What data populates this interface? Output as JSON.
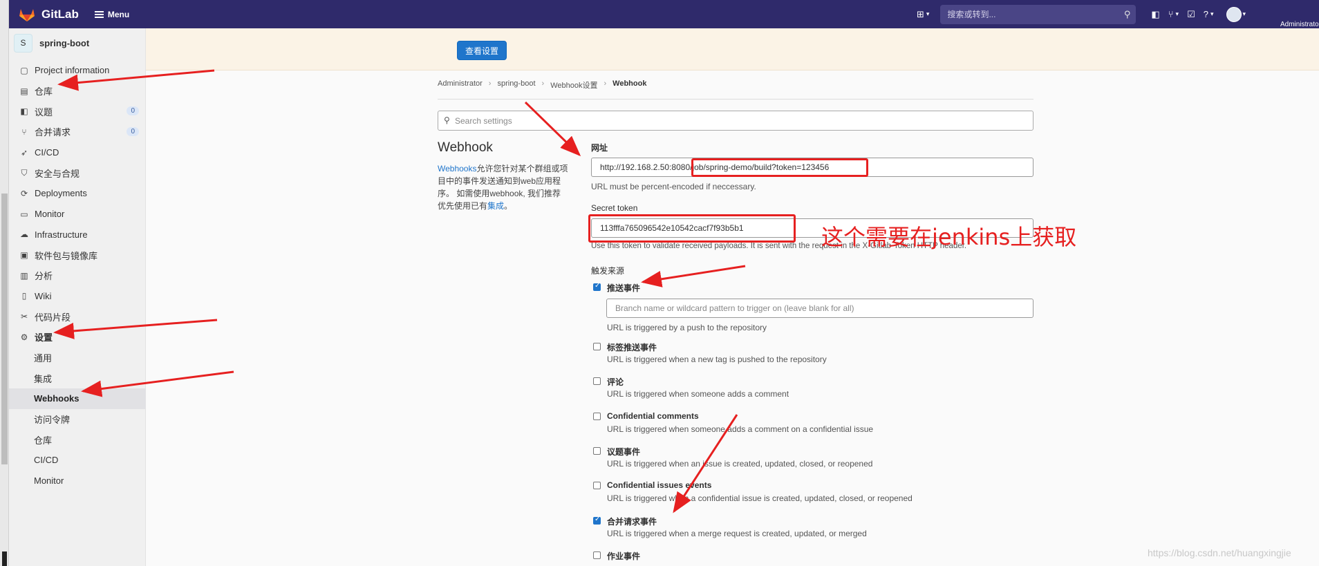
{
  "topbar": {
    "brand": "GitLab",
    "menu_label": "Menu",
    "search_placeholder": "搜索或转到...",
    "user_label": "Administrator"
  },
  "sidebar": {
    "project_initial": "S",
    "project_name": "spring-boot",
    "items": [
      {
        "label": "Project information",
        "icon": "info-icon"
      },
      {
        "label": "仓库",
        "icon": "repository-icon"
      },
      {
        "label": "议题",
        "icon": "issues-icon",
        "badge": "0"
      },
      {
        "label": "合并请求",
        "icon": "merge-request-icon",
        "badge": "0"
      },
      {
        "label": "CI/CD",
        "icon": "rocket-icon"
      },
      {
        "label": "安全与合规",
        "icon": "shield-icon"
      },
      {
        "label": "Deployments",
        "icon": "deployments-icon"
      },
      {
        "label": "Monitor",
        "icon": "monitor-icon"
      },
      {
        "label": "Infrastructure",
        "icon": "cloud-icon"
      },
      {
        "label": "软件包与镜像库",
        "icon": "package-icon"
      },
      {
        "label": "分析",
        "icon": "chart-icon"
      },
      {
        "label": "Wiki",
        "icon": "book-icon"
      },
      {
        "label": "代码片段",
        "icon": "scissors-icon"
      },
      {
        "label": "设置",
        "icon": "gear-icon"
      }
    ],
    "settings_sub": [
      "通用",
      "集成",
      "Webhooks",
      "访问令牌",
      "仓库",
      "CI/CD",
      "Monitor"
    ]
  },
  "banner": {
    "button_label": "查看设置"
  },
  "breadcrumb": [
    "Administrator",
    "spring-boot",
    "Webhook设置",
    "Webhook"
  ],
  "settings_search_placeholder": "Search settings",
  "webhook": {
    "title": "Webhook",
    "desc_link": "Webhooks",
    "desc_text": "允许您针对某个群组或项目中的事件发送通知到web应用程序。 如需使用webhook, 我们推荐优先使用已有",
    "desc_link2": "集成",
    "desc_end": "。"
  },
  "form": {
    "url_label": "网址",
    "url_value": "http://192.168.2.50:8080/job/spring-demo/build?token=123456",
    "url_help": "URL must be percent-encoded if neccessary.",
    "token_label": "Secret token",
    "token_value": "113fffa765096542e10542cacf7f93b5b1",
    "token_help": "Use this token to validate received payloads. It is sent with the request in the X-Gitlab-Token HTTP header.",
    "trigger_label": "触发来源",
    "branch_placeholder": "Branch name or wildcard pattern to trigger on (leave blank for all)",
    "triggers": [
      {
        "label": "推送事件",
        "help": "URL is triggered by a push to the repository",
        "checked": true
      },
      {
        "label": "标签推送事件",
        "help": "URL is triggered when a new tag is pushed to the repository",
        "checked": false
      },
      {
        "label": "评论",
        "help": "URL is triggered when someone adds a comment",
        "checked": false
      },
      {
        "label": "Confidential comments",
        "help": "URL is triggered when someone adds a comment on a confidential issue",
        "checked": false
      },
      {
        "label": "议题事件",
        "help": "URL is triggered when an issue is created, updated, closed, or reopened",
        "checked": false
      },
      {
        "label": "Confidential issues events",
        "help": "URL is triggered when a confidential issue is created, updated, closed, or reopened",
        "checked": false
      },
      {
        "label": "合并请求事件",
        "help": "URL is triggered when a merge request is created, updated, or merged",
        "checked": true
      },
      {
        "label": "作业事件",
        "help": "",
        "checked": false
      }
    ]
  },
  "annotation": "这个需要在jenkins上获取",
  "watermark": "https://blog.csdn.net/huangxingjie",
  "colors": {
    "topbar": "#2f2a6b",
    "primary": "#1f75cb",
    "annotation": "#e62020"
  }
}
